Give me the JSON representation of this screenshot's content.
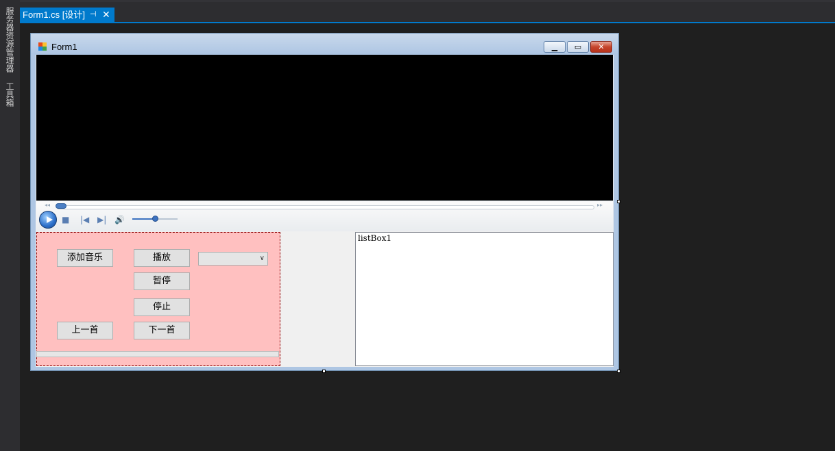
{
  "left_toolbar": {
    "items": [
      "服务器资源管理器",
      "工具箱"
    ]
  },
  "document_tab": {
    "title": "Form1.cs [设计]",
    "pin_icon": "pin-icon",
    "close_icon": "close-icon"
  },
  "form": {
    "title": "Form1",
    "caption_buttons": {
      "minimize": "minimize-icon",
      "maximize": "maximize-icon",
      "close": "close-icon"
    },
    "media_player": {
      "seek_progress": 0.0,
      "volume": 0.5
    },
    "buttons": {
      "add_music": "添加音乐",
      "play": "播放",
      "pause": "暂停",
      "stop": "停止",
      "previous": "上一首",
      "next": "下一首"
    },
    "combo_box": {
      "value": ""
    },
    "progress_bar": {
      "value": 0
    },
    "list_box": {
      "text": "listBox1"
    }
  },
  "colors": {
    "ide_background": "#1f1f1f",
    "accent": "#007acc",
    "panel_background": "#ffc0c0",
    "panel_border": "#8b0000",
    "video_background": "#000000"
  }
}
